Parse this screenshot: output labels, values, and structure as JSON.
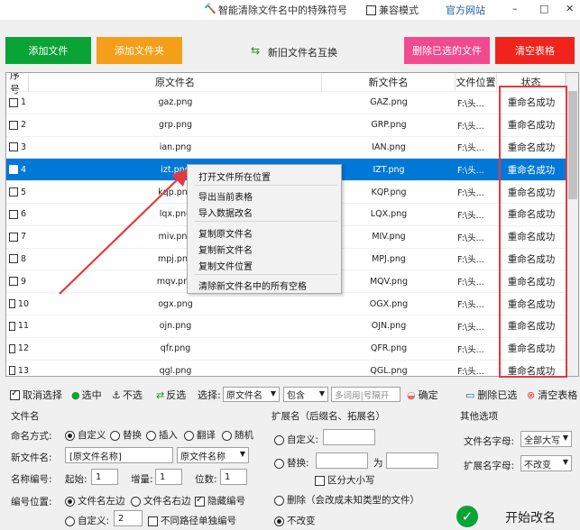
{
  "titlebar": {
    "app_title": "智能清除文件名中的特殊符号",
    "compat_label": "兼容模式",
    "website_label": "官方网站",
    "minimize_glyph": "–",
    "maximize_glyph": "□",
    "close_glyph": "✕"
  },
  "actions": {
    "add_file": "添加文件",
    "add_folder": "添加文件夹",
    "swap_names": "新旧文件名互换",
    "delete_selected": "删除已选的文件",
    "clear_table": "清空表格"
  },
  "table": {
    "columns": [
      "序号",
      "原文件名",
      "新文件名",
      "文件位置",
      "状态"
    ],
    "rows": [
      {
        "no": "1",
        "orig": "gaz.png",
        "new": "GAZ.png",
        "loc": "F:\\头...",
        "status": "重命名成功"
      },
      {
        "no": "2",
        "orig": "grp.png",
        "new": "GRP.png",
        "loc": "F:\\头...",
        "status": "重命名成功"
      },
      {
        "no": "3",
        "orig": "ian.png",
        "new": "IAN.png",
        "loc": "F:\\头...",
        "status": "重命名成功"
      },
      {
        "no": "4",
        "orig": "izt.png",
        "new": "IZT.png",
        "loc": "F:\\头...",
        "status": "重命名成功"
      },
      {
        "no": "5",
        "orig": "kqp.png",
        "new": "KQP.png",
        "loc": "F:\\头...",
        "status": "重命名成功"
      },
      {
        "no": "6",
        "orig": "lqx.png",
        "new": "LQX.png",
        "loc": "F:\\头...",
        "status": "重命名成功"
      },
      {
        "no": "7",
        "orig": "miv.png",
        "new": "MIV.png",
        "loc": "F:\\头...",
        "status": "重命名成功"
      },
      {
        "no": "8",
        "orig": "mpj.png",
        "new": "MPJ.png",
        "loc": "F:\\头...",
        "status": "重命名成功"
      },
      {
        "no": "9",
        "orig": "mqv.png",
        "new": "MQV.png",
        "loc": "F:\\头...",
        "status": "重命名成功"
      },
      {
        "no": "10",
        "orig": "ogx.png",
        "new": "OGX.png",
        "loc": "F:\\头...",
        "status": "重命名成功"
      },
      {
        "no": "11",
        "orig": "ojn.png",
        "new": "OJN.png",
        "loc": "F:\\头...",
        "status": "重命名成功"
      },
      {
        "no": "12",
        "orig": "qfr.png",
        "new": "QFR.png",
        "loc": "F:\\头...",
        "status": "重命名成功"
      },
      {
        "no": "13",
        "orig": "qgl.png",
        "new": "QGL.png",
        "loc": "F:\\头...",
        "status": "重命名成功"
      }
    ]
  },
  "context_menu": {
    "items": [
      "打开文件所在位置",
      "导出当前表格",
      "导入数据改名",
      "复制原文件名",
      "复制新文件名",
      "复制文件位置",
      "清除新文件名中的所有空格"
    ]
  },
  "toolbar": {
    "cancel_select": "取消选择",
    "select": "选中",
    "unselect": "不选",
    "invert": "反选",
    "select_label": "选择:",
    "field_value": "原文件名",
    "op_value": "包含",
    "search_placeholder": "多词用|号隔开",
    "confirm": "确定",
    "delete_selected": "删除已选",
    "clear_table": "清空表格"
  },
  "filename_panel": {
    "title": "文件名",
    "mode_label": "命名方式:",
    "modes": [
      "自定义",
      "替换",
      "插入",
      "翻译",
      "随机"
    ],
    "new_name_label": "新文件名:",
    "new_name_value": "[原文件名称]",
    "new_name_select": "原文件名称",
    "numbering_label": "名称编号:",
    "start_label": "起始:",
    "start_value": "1",
    "step_label": "增量:",
    "step_value": "1",
    "digits_label": "位数:",
    "digits_value": "1",
    "position_label": "编号位置:",
    "pos_left": "文件名左边",
    "pos_right": "文件名右边",
    "hide_number": "隐藏编号",
    "pos_custom": "自定义:",
    "custom_value": "2",
    "separate_path": "不同路径单独编号"
  },
  "ext_panel": {
    "title": "扩展名（后缀名、拓展名）",
    "custom": "自定义:",
    "replace": "替换:",
    "to_label": "为",
    "case_sensitive": "区分大小写",
    "delete": "删除（会改成未知类型的文件）",
    "no_change": "不改变"
  },
  "other_panel": {
    "title": "其他选项",
    "name_case_label": "文件名字母:",
    "name_case_value": "全部大写",
    "ext_case_label": "扩展名字母:",
    "ext_case_value": "不改变",
    "start_button": "开始改名"
  },
  "colors": {
    "green": "#0aa336",
    "orange": "#f49e1a",
    "pink": "#f24a8f",
    "red": "#f0241c",
    "select_blue": "#0078d7",
    "annot_red": "#e8383d"
  }
}
